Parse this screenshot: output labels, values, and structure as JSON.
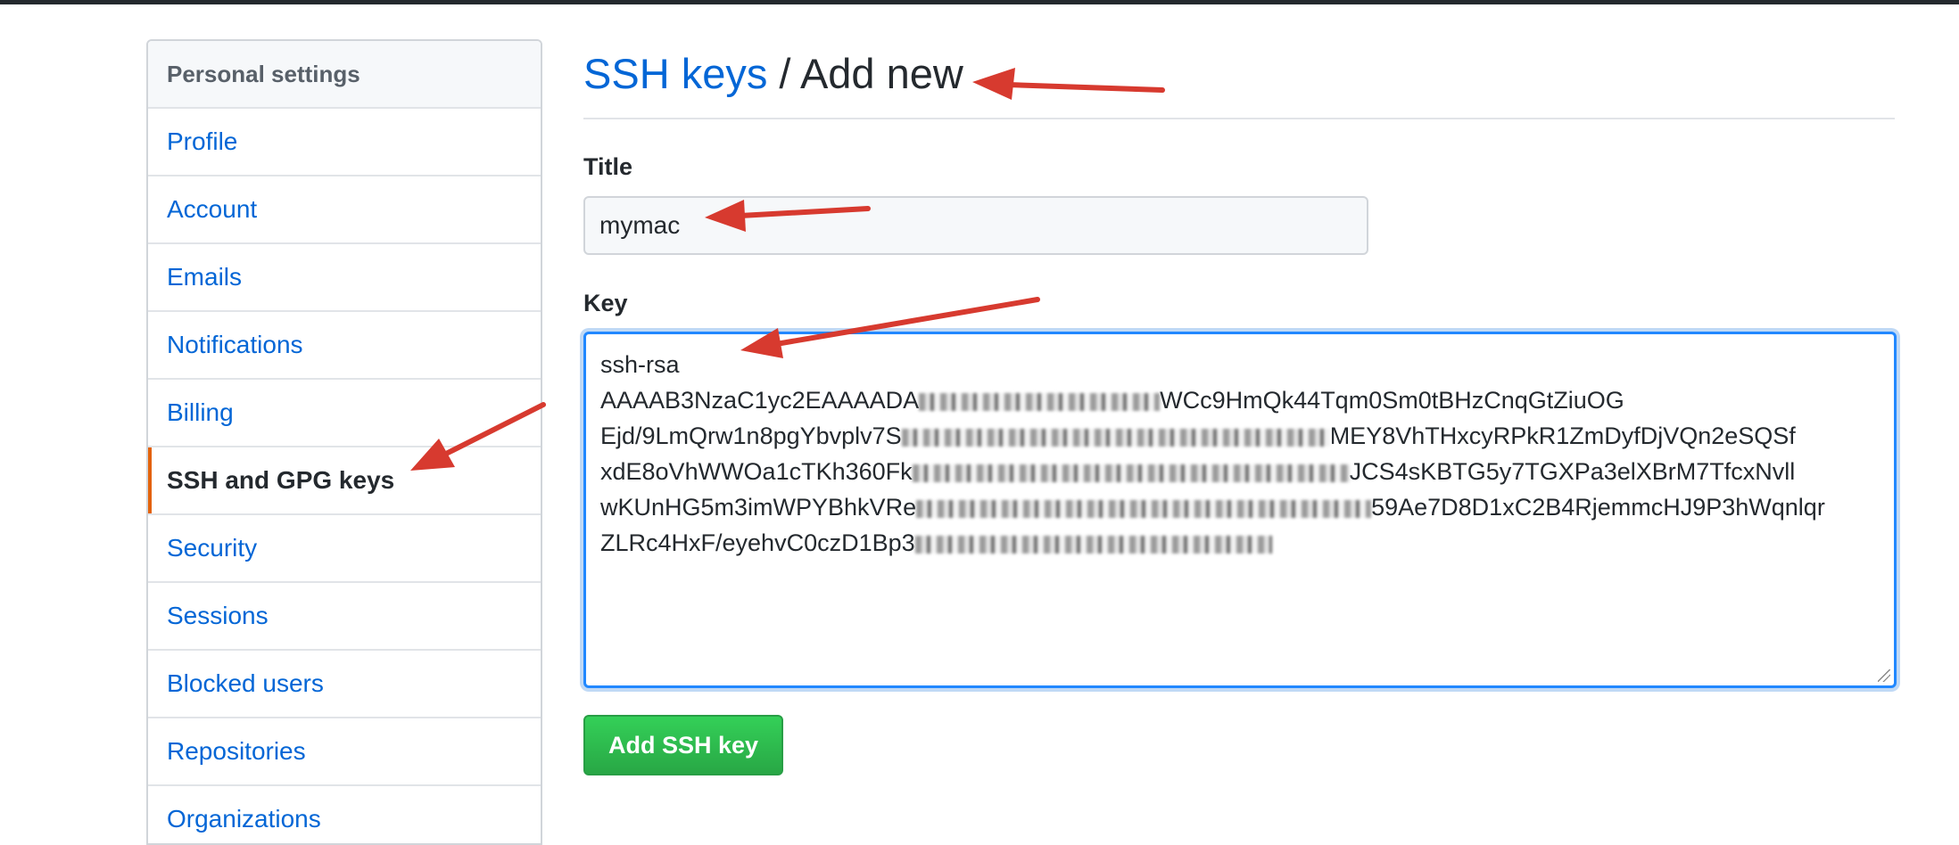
{
  "sidebar": {
    "header": "Personal settings",
    "items": [
      {
        "label": "Profile"
      },
      {
        "label": "Account"
      },
      {
        "label": "Emails"
      },
      {
        "label": "Notifications"
      },
      {
        "label": "Billing"
      },
      {
        "label": "SSH and GPG keys",
        "active": true
      },
      {
        "label": "Security"
      },
      {
        "label": "Sessions"
      },
      {
        "label": "Blocked users"
      },
      {
        "label": "Repositories"
      },
      {
        "label": "Organizations"
      }
    ]
  },
  "heading": {
    "link": "SSH keys",
    "separator": "/",
    "current": "Add new"
  },
  "form": {
    "title_label": "Title",
    "title_value": "mymac",
    "key_label": "Key",
    "key_lines": [
      {
        "pre": "ssh-rsa",
        "post": ""
      },
      {
        "pre": "AAAAB3NzaC1yc2EAAAADA",
        "post": "WCc9HmQk44Tqm0Sm0tBHzCnqGtZiuOG"
      },
      {
        "pre": "Ejd/9LmQrw1n8pgYbvplv7S",
        "post": "MEY8VhTHxcyRPkR1ZmDyfDjVQn2eSQSf"
      },
      {
        "pre": "xdE8oVhWWOa1cTKh360Fk",
        "post": "JCS4sKBTG5y7TGXPa3elXBrM7TfcxNvll"
      },
      {
        "pre": "wKUnHG5m3imWPYBhkVRe",
        "post": "59Ae7D8D1xC2B4RjemmcHJ9P3hWqnlqr"
      },
      {
        "pre": "ZLRc4HxF/eyehvC0czD1Bp3",
        "post": ""
      }
    ],
    "submit_label": "Add SSH key"
  },
  "colors": {
    "link": "#0366d6",
    "active_indicator": "#e36209",
    "button_green": "#28a745",
    "focus_border": "#2188ff",
    "annotation_arrow": "#d73a2f"
  }
}
